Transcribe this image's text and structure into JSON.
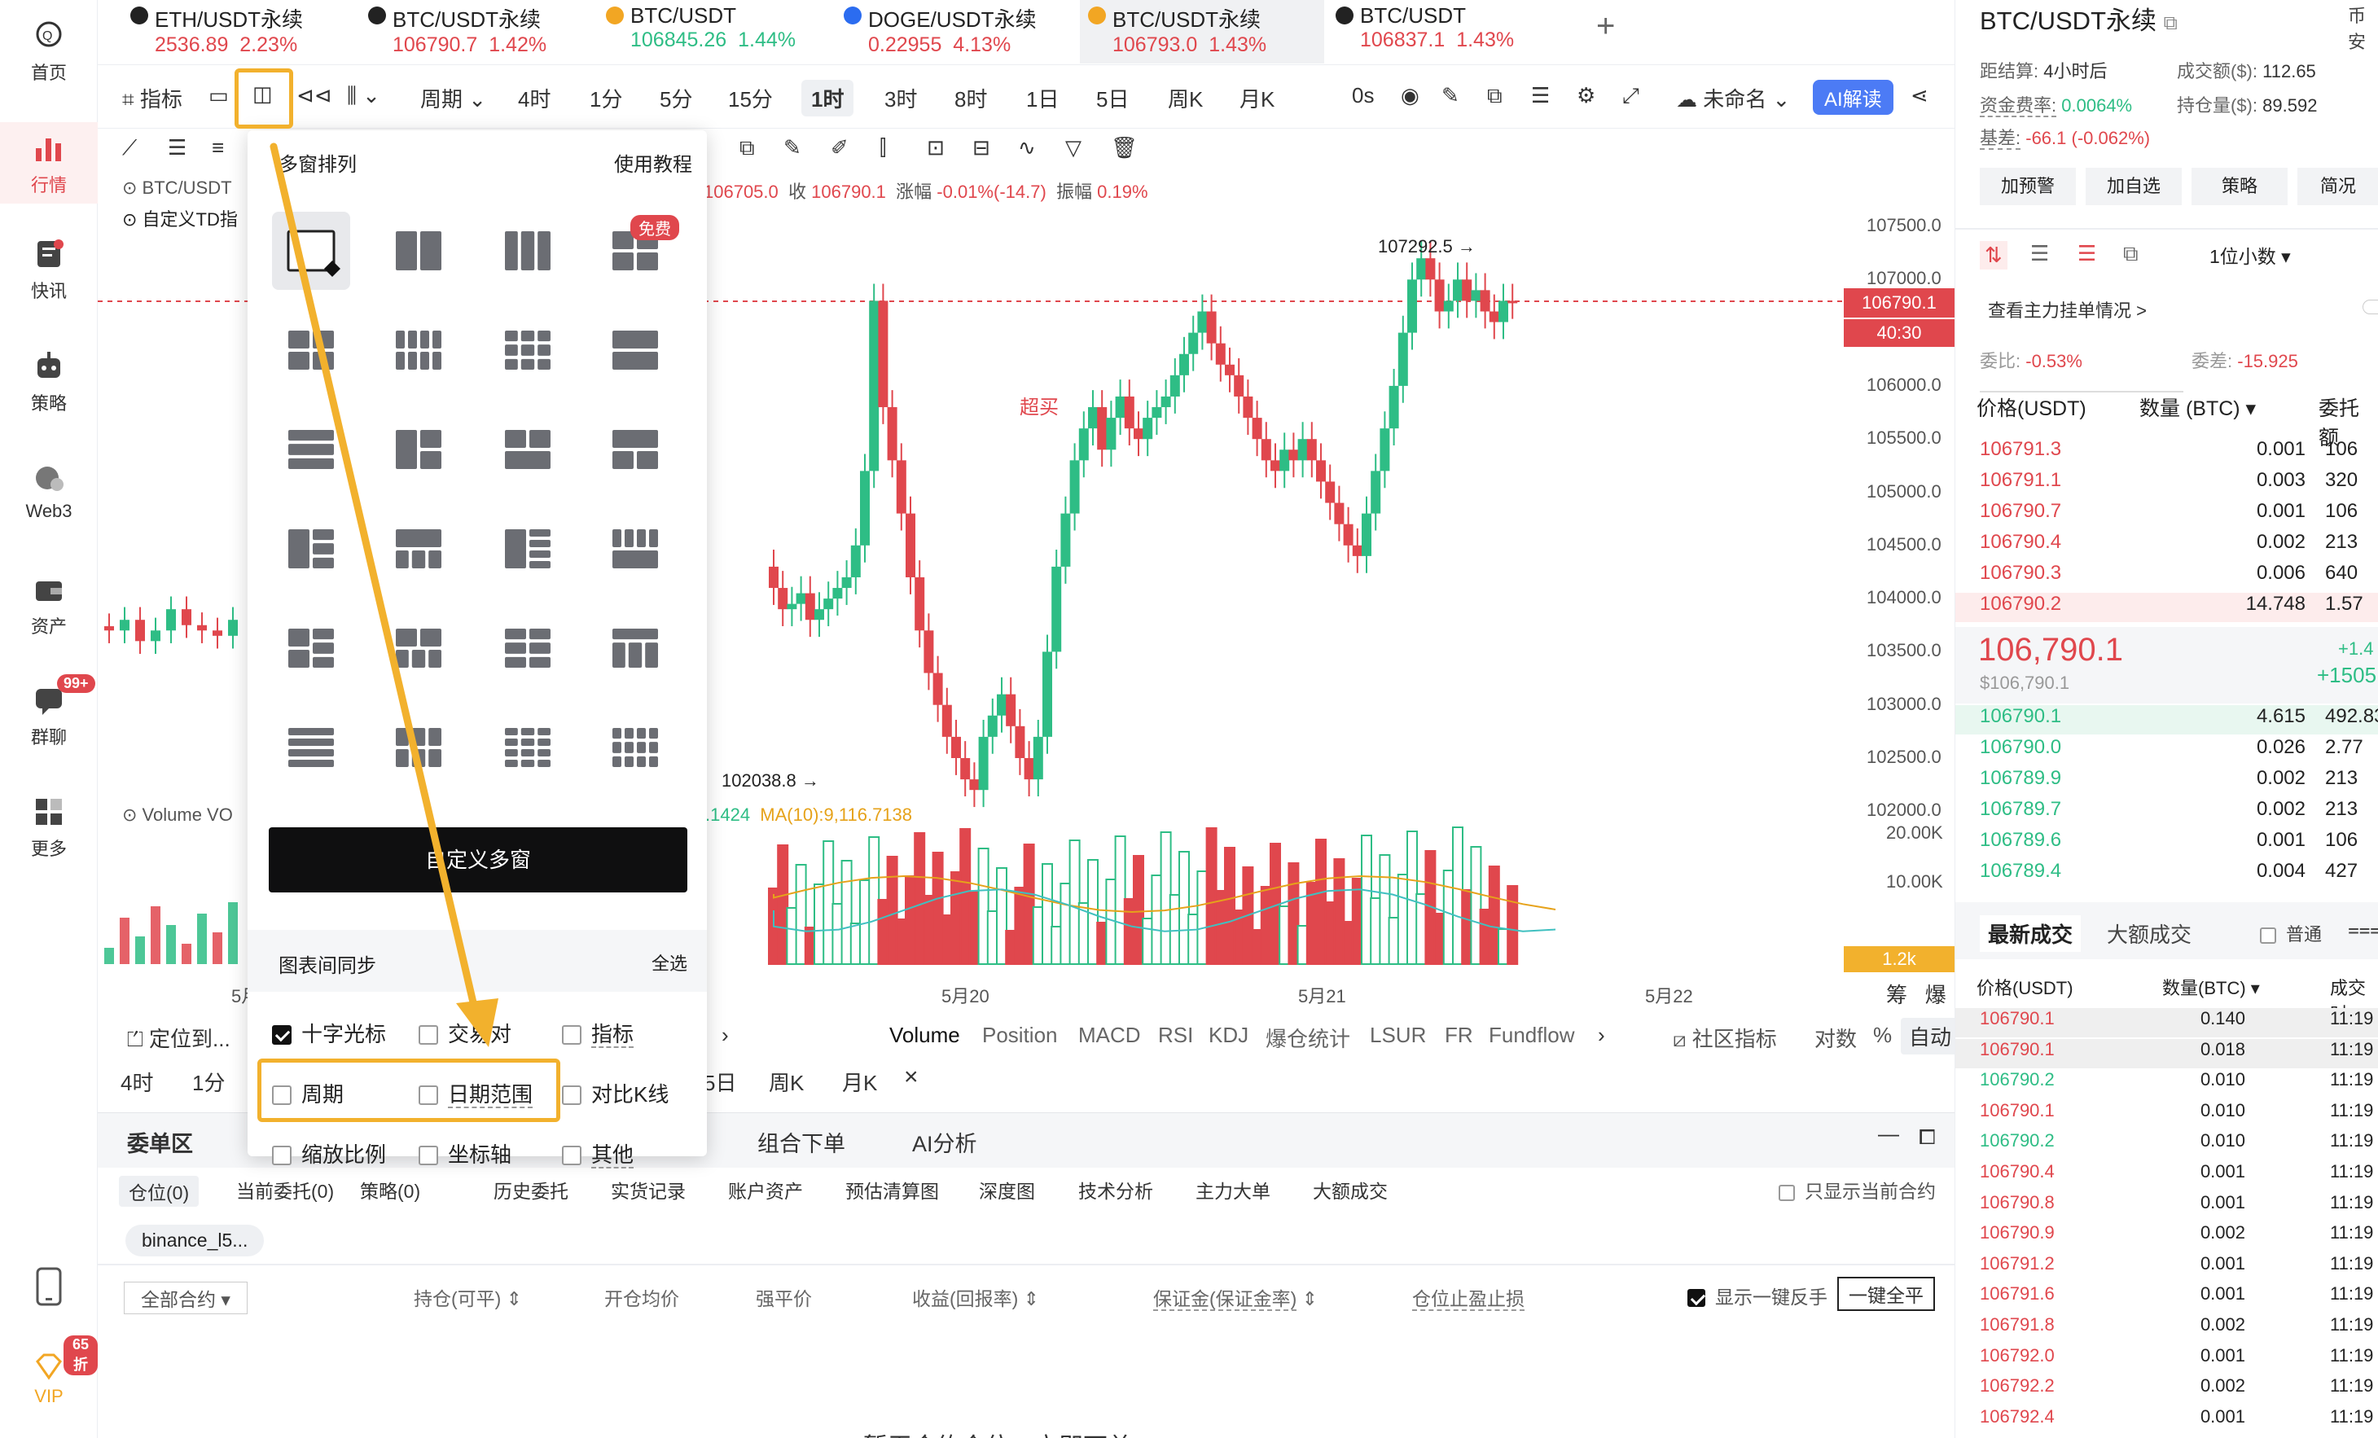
{
  "nav": {
    "items": [
      {
        "label": "首页",
        "icon": "home-icon"
      },
      {
        "label": "行情",
        "icon": "market-chart-icon",
        "active": true
      },
      {
        "label": "快讯",
        "icon": "news-icon"
      },
      {
        "label": "策略",
        "icon": "robot-icon"
      },
      {
        "label": "Web3",
        "icon": "web3-icon"
      },
      {
        "label": "资产",
        "icon": "wallet-icon"
      },
      {
        "label": "群聊",
        "icon": "chat-icon",
        "badge": "99+"
      },
      {
        "label": "更多",
        "icon": "more-grid-icon"
      }
    ],
    "phone_icon": "phone-icon",
    "vip": {
      "label": "VIP",
      "badge": "65折"
    }
  },
  "tabs": [
    {
      "name": "ETH/USDT永续",
      "price": "2536.89",
      "change": "2.23%"
    },
    {
      "name": "BTC/USDT永续",
      "price": "106790.7",
      "change": "1.42%"
    },
    {
      "name": "BTC/USDT",
      "price": "106845.26",
      "change": "1.44%"
    },
    {
      "name": "DOGE/USDT永续",
      "price": "0.22955",
      "change": "4.13%"
    },
    {
      "name": "BTC/USDT永续",
      "price": "106793.0",
      "change": "1.43%",
      "active": true
    },
    {
      "name": "BTC/USDT",
      "price": "106837.1",
      "change": "1.43%"
    }
  ],
  "toolbar": {
    "indicator": "指标",
    "period": "周期",
    "intervals": [
      "4时",
      "1分",
      "5分",
      "15分",
      "1时",
      "3时",
      "8时",
      "1日",
      "5日",
      "周K",
      "月K"
    ],
    "active_interval": "1时",
    "countdown": "0s",
    "unnamed": "未命名",
    "ai": "AI解读"
  },
  "legend": {
    "symbol": "BTC/USDT",
    "custom_td": "自定义TD指",
    "ohlc_tail": "106705.0",
    "close_label": "收",
    "close": "106790.1",
    "amp_label": "涨幅",
    "amp": "-0.01%(-14.7)",
    "vib_label": "振幅",
    "vib": "0.19%",
    "volume_label": "Volume",
    "vol_tail": ".1424",
    "ma10": "MA(10):9,116.7138"
  },
  "chart_data": {
    "type": "candlestick",
    "y_ticks": [
      "107500.0",
      "107000.0",
      "106500.0",
      "106000.0",
      "105500.0",
      "105000.0",
      "104500.0",
      "104000.0",
      "103500.0",
      "103000.0",
      "102500.0",
      "102000.0"
    ],
    "vol_ticks": [
      "20.00K",
      "10.00K"
    ],
    "vol_badge": "1.2k",
    "x_ticks": [
      "5月",
      "5月20",
      "5月21",
      "5月22"
    ],
    "high_label": "107292.5 →",
    "low_label": "102038.8 →",
    "overbought": "超买",
    "price_badge": "106790.1",
    "countdown_badge": "40:30",
    "scale_labels": [
      "筹",
      "爆"
    ]
  },
  "bottom": {
    "locate": "定位到...",
    "indicators": [
      "Volume",
      "Position",
      "MACD",
      "RSI",
      "KDJ",
      "爆仓统计",
      "LSUR",
      "FR",
      "Fundflow"
    ],
    "community": "社区指标",
    "log": "对数",
    "pct": "%",
    "auto": "自动",
    "intervals2": [
      "4时",
      "1分",
      "5日",
      "周K",
      "月K"
    ]
  },
  "orders": {
    "tabs": [
      "委单区",
      "组合下单",
      "AI分析"
    ],
    "subtabs": [
      "仓位(0)",
      "当前委托(0)",
      "策略(0)",
      "历史委托",
      "实货记录",
      "账户资产",
      "预估清算图",
      "深度图",
      "技术分析",
      "主力大单",
      "大额成交"
    ],
    "only_current": "只显示当前合约",
    "chip": "binance_l5...",
    "cols": [
      "全部合约",
      "持仓(可平)",
      "开仓均价",
      "强平价",
      "收益(回报率)",
      "保证金(保证金率)",
      "仓位止盈止损"
    ],
    "show_reverse": "显示一键反手",
    "close_all": "一键全平",
    "empty": "暂无合约仓位，立即下单 >"
  },
  "popup": {
    "title": "多窗排列",
    "tutorial": "使用教程",
    "free": "免费",
    "custom": "自定义多窗",
    "sync": "图表间同步",
    "select_all": "全选",
    "options": [
      {
        "label": "十字光标",
        "checked": true
      },
      {
        "label": "交易对",
        "checked": false
      },
      {
        "label": "指标",
        "checked": false
      },
      {
        "label": "周期",
        "checked": false
      },
      {
        "label": "日期范围",
        "checked": false
      },
      {
        "label": "对比K线",
        "checked": false
      },
      {
        "label": "缩放比例",
        "checked": false
      },
      {
        "label": "坐标轴",
        "checked": false
      },
      {
        "label": "其他",
        "checked": false
      }
    ]
  },
  "right": {
    "title": "BTC/USDT永续",
    "side": "币安",
    "settle_label": "距结算:",
    "settle": "4小时后",
    "vol_label": "成交额($):",
    "vol": "112.65",
    "fund_label": "资金费率:",
    "fund": "0.0064%",
    "oi_label": "持仓量($):",
    "oi": "89.592",
    "basis_label": "基差:",
    "basis": "-66.1 (-0.062%)",
    "buttons": [
      "加预警",
      "加自选",
      "策略",
      "简况"
    ],
    "decimals": "1位小数",
    "main_order": "查看主力挂单情况 >",
    "ratio_label": "委比:",
    "ratio": "-0.53%",
    "diff_label": "委差:",
    "diff": "-15.925",
    "cols": [
      "价格(USDT)",
      "数量 (BTC)",
      "委托额"
    ],
    "asks": [
      [
        "106791.3",
        "0.001",
        "106"
      ],
      [
        "106791.1",
        "0.003",
        "320"
      ],
      [
        "106790.7",
        "0.001",
        "106"
      ],
      [
        "106790.4",
        "0.002",
        "213"
      ],
      [
        "106790.3",
        "0.006",
        "640"
      ],
      [
        "106790.2",
        "14.748",
        "1.57"
      ]
    ],
    "mid": "106,790.1",
    "mid_usd": "$106,790.1",
    "mid_r1": "+1.4",
    "mid_r2": "+1505",
    "bids": [
      [
        "106790.1",
        "4.615",
        "492.83"
      ],
      [
        "106790.0",
        "0.026",
        "2.77"
      ],
      [
        "106789.9",
        "0.002",
        "213"
      ],
      [
        "106789.7",
        "0.002",
        "213"
      ],
      [
        "106789.6",
        "0.001",
        "106"
      ],
      [
        "106789.4",
        "0.004",
        "427"
      ]
    ],
    "trade_tabs": [
      "最新成交",
      "大额成交"
    ],
    "normal": "普通",
    "tcols": [
      "价格(USDT)",
      "数量(BTC)",
      "成交时"
    ],
    "trades": [
      [
        "106790.1",
        "0.140",
        "11:19",
        "dn"
      ],
      [
        "106790.1",
        "0.018",
        "11:19",
        "dn"
      ],
      [
        "106790.2",
        "0.010",
        "11:19",
        "up"
      ],
      [
        "106790.1",
        "0.010",
        "11:19",
        "dn"
      ],
      [
        "106790.2",
        "0.010",
        "11:19",
        "up"
      ],
      [
        "106790.4",
        "0.001",
        "11:19",
        "dn"
      ],
      [
        "106790.8",
        "0.001",
        "11:19",
        "dn"
      ],
      [
        "106790.9",
        "0.002",
        "11:19",
        "dn"
      ],
      [
        "106791.2",
        "0.001",
        "11:19",
        "dn"
      ],
      [
        "106791.6",
        "0.001",
        "11:19",
        "dn"
      ],
      [
        "106791.8",
        "0.002",
        "11:19",
        "dn"
      ],
      [
        "106792.0",
        "0.001",
        "11:19",
        "dn"
      ],
      [
        "106792.2",
        "0.002",
        "11:19",
        "dn"
      ],
      [
        "106792.4",
        "0.001",
        "11:19",
        "dn"
      ]
    ]
  },
  "colors": {
    "up": "#2ebd85",
    "down": "#e0474d",
    "highlight": "#f2b12d"
  }
}
